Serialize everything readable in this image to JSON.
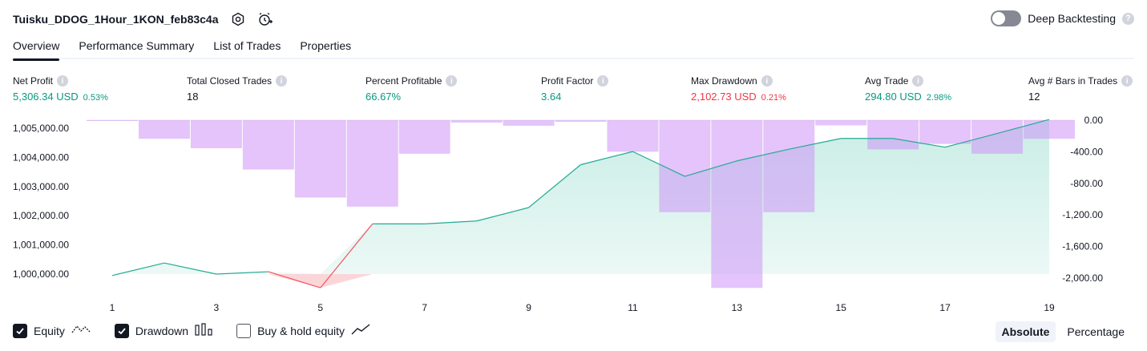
{
  "header": {
    "strategy_name": "Tuisku_DDOG_1Hour_1KON_feb83c4a",
    "settings_icon": "gear-icon",
    "alert_icon": "alarm-clock-add-icon"
  },
  "deep_backtesting": {
    "label": "Deep Backtesting",
    "enabled": false,
    "help": "?"
  },
  "tabs": [
    {
      "label": "Overview",
      "active": true
    },
    {
      "label": "Performance Summary",
      "active": false
    },
    {
      "label": "List of Trades",
      "active": false
    },
    {
      "label": "Properties",
      "active": false
    }
  ],
  "metrics": [
    {
      "label": "Net Profit",
      "value": "5,306.34 USD",
      "sub": "0.53%",
      "tone": "pos"
    },
    {
      "label": "Total Closed Trades",
      "value": "18",
      "sub": "",
      "tone": "neutral"
    },
    {
      "label": "Percent Profitable",
      "value": "66.67%",
      "sub": "",
      "tone": "pos"
    },
    {
      "label": "Profit Factor",
      "value": "3.64",
      "sub": "",
      "tone": "pos"
    },
    {
      "label": "Max Drawdown",
      "value": "2,102.73 USD",
      "sub": "0.21%",
      "tone": "neg"
    },
    {
      "label": "Avg Trade",
      "value": "294.80 USD",
      "sub": "2.98%",
      "tone": "pos"
    },
    {
      "label": "Avg # Bars in Trades",
      "value": "12",
      "sub": "",
      "tone": "neutral"
    }
  ],
  "chart_data": {
    "type": "line",
    "x": [
      1,
      2,
      3,
      4,
      5,
      6,
      7,
      8,
      9,
      10,
      11,
      12,
      13,
      14,
      15,
      16,
      17,
      18,
      19
    ],
    "x_tick_labels": [
      "1",
      "3",
      "5",
      "7",
      "9",
      "11",
      "13",
      "15",
      "17",
      "19"
    ],
    "series": [
      {
        "name": "Equity",
        "type": "area",
        "axis": "left",
        "values": [
          999950,
          1000380,
          1000000,
          1000080,
          999530,
          1001720,
          1001720,
          1001820,
          1002280,
          1003750,
          1004200,
          1003350,
          1003880,
          1004280,
          1004650,
          1004650,
          1004350,
          1004820,
          1005300
        ]
      },
      {
        "name": "Drawdown",
        "type": "bar",
        "axis": "right",
        "values": [
          -5,
          -235,
          -355,
          -625,
          -980,
          -1095,
          -425,
          -30,
          -70,
          -20,
          -400,
          -1165,
          -2125,
          -1165,
          -65,
          -370,
          -300,
          -425,
          -235
        ]
      }
    ],
    "y_left_ticks": [
      "1,005,000.00",
      "1,004,000.00",
      "1,003,000.00",
      "1,002,000.00",
      "1,001,000.00",
      "1,000,000.00"
    ],
    "y_right_ticks": [
      "0.00",
      "-400.00",
      "-800.00",
      "-1,200.00",
      "-1,600.00",
      "-2,000.00"
    ],
    "y_left_range": [
      1000000,
      1005000
    ],
    "y_right_range": [
      -2000,
      0
    ],
    "colors": {
      "equity_line": "#22ab94",
      "equity_negative_line": "#f7525f",
      "equity_fill": "#c9ede5",
      "drawdown_bar": "#ce93f8",
      "drawdown_overlap": "#9fb5e0"
    }
  },
  "legend": [
    {
      "label": "Equity",
      "checked": true,
      "icon": "equity-line-icon"
    },
    {
      "label": "Drawdown",
      "checked": true,
      "icon": "drawdown-bars-icon"
    },
    {
      "label": "Buy & hold equity",
      "checked": false,
      "icon": "buy-hold-line-icon"
    }
  ],
  "view_mode": {
    "absolute": "Absolute",
    "percentage": "Percentage",
    "active": "absolute"
  }
}
